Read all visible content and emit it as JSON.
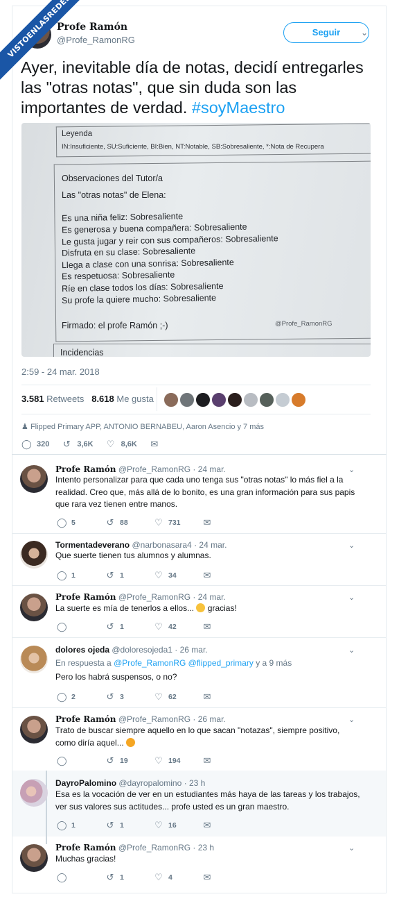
{
  "watermark": "VISTOENLASREDES",
  "tweet": {
    "author_name": "𝐏𝐫𝐨𝐟𝐞 𝐑𝐚𝐦ó𝐧",
    "author_handle": "@Profe_RamonRG",
    "follow_label": "Seguir",
    "text_main": "Ayer, inevitable día de notas, decidí entregarles las \"otras notas\", que sin duda son las importantes de verdad. ",
    "hashtag": "#soyMaestro",
    "timestamp": "2:59 - 24 mar. 2018",
    "retweets_count": "3.581",
    "retweets_label": "Retweets",
    "likes_count": "8.618",
    "likes_label": "Me gusta",
    "thanks_line": "Flipped Primary APP, ANTONIO BERNABEU, Aaron Asencio y 7 más",
    "actions": {
      "replies": "320",
      "retweets": "3,6K",
      "likes": "8,6K"
    }
  },
  "photo": {
    "legend_title": "Leyenda",
    "legend_line": "IN:Insuficiente, SU:Suficiente, BI:Bien, NT:Notable, SB:Sobresaliente, *:Nota de Recupera",
    "obs_title": "Observaciones del Tutor/a",
    "obs_subtitle": "Las \"otras notas\" de Elena:",
    "lines": [
      "Es una niña feliz: Sobresaliente",
      "Es generosa y buena compañera: Sobresaliente",
      "Le gusta jugar y reir con sus compañeros: Sobresaliente",
      "Disfruta en su clase: Sobresaliente",
      "Llega a clase con una sonrisa: Sobresaliente",
      "Es respetuosa: Sobresaliente",
      "Ríe en clase todos los días: Sobresaliente",
      "Su profe la quiere mucho: Sobresaliente"
    ],
    "signature": "Firmado: el profe Ramón ;-)",
    "photo_watermark": "@Profe_RamonRG",
    "incidencias": "Incidencias"
  },
  "replies": [
    {
      "name": "𝐏𝐫𝐨𝐟𝐞 𝐑𝐚𝐦ó𝐧",
      "handle": "@Profe_RamonRG",
      "date": "24 mar.",
      "text": "Intento personalizar para que cada uno tenga sus \"otras notas\" lo más fiel a la realidad. Creo que, más allá de lo bonito, es una gran información para sus papis que rara vez tienen entre manos.",
      "replies": "5",
      "retweets": "88",
      "likes": "731"
    },
    {
      "name": "Tormentadeverano",
      "handle": "@narbonasara4",
      "date": "24 mar.",
      "text": "Que suerte tienen tus alumnos y alumnas.",
      "replies": "1",
      "retweets": "1",
      "likes": "34"
    },
    {
      "name": "𝐏𝐫𝐨𝐟𝐞 𝐑𝐚𝐦ó𝐧",
      "handle": "@Profe_RamonRG",
      "date": "24 mar.",
      "text_a": "La suerte es mía de tenerlos a ellos...",
      "text_b": "gracias!",
      "replies": "",
      "retweets": "1",
      "likes": "42"
    },
    {
      "name": "dolores ojeda",
      "handle": "@doloresojeda1",
      "date": "26 mar.",
      "inreply_prefix": "En respuesta a",
      "inreply_links": "@Profe_RamonRG @flipped_primary",
      "inreply_suffix": "y a 9 más",
      "text": "Pero los habrá suspensos, o no?",
      "replies": "2",
      "retweets": "3",
      "likes": "62"
    },
    {
      "name": "𝐏𝐫𝐨𝐟𝐞 𝐑𝐚𝐦ó𝐧",
      "handle": "@Profe_RamonRG",
      "date": "26 mar.",
      "text": "Trato de buscar siempre aquello en lo que sacan \"notazas\", siempre positivo, como diría aquel...",
      "replies": "",
      "retweets": "19",
      "likes": "194"
    },
    {
      "name": "DayroPalomino",
      "handle": "@dayropalomino",
      "date": "23 h",
      "text": "Esa es la vocación de ver en un estudiantes más haya de las tareas y los trabajos, ver sus valores sus actitudes... profe usted es un gran maestro.",
      "replies": "1",
      "retweets": "1",
      "likes": "16"
    },
    {
      "name": "𝐏𝐫𝐨𝐟𝐞 𝐑𝐚𝐦ó𝐧",
      "handle": "@Profe_RamonRG",
      "date": "23 h",
      "text": "Muchas gracias!",
      "replies": "",
      "retweets": "1",
      "likes": "4"
    }
  ]
}
